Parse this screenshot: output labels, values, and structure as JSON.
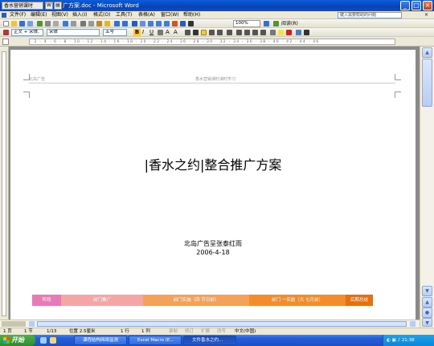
{
  "window": {
    "app_tag": "香水营销课时",
    "doc_title": "广方案.doc - Microsoft Word",
    "min": "_",
    "max": "□",
    "close": "×"
  },
  "menu": {
    "items": [
      "文件(F)",
      "编辑(E)",
      "视图(V)",
      "插入(I)",
      "格式(O)",
      "工具(T)",
      "表格(A)",
      "窗口(W)",
      "帮助(H)"
    ],
    "help_placeholder": "键入需要帮助的问题"
  },
  "toolbar": {
    "zoom": "100%",
    "read_label": "阅读(R)",
    "style": "正文 + 宋体,",
    "font": "宋体",
    "size": "五号"
  },
  "document": {
    "header_left": "北岛广告",
    "header_center": "香水营销课时课时学习",
    "title": "|香水之约|整合推广方案",
    "company": "北岛广告呈张泰红雨",
    "date": "2006-4-18",
    "table_headers": [
      "阶段",
      "前门推广",
      "前门实施（四 节日前）",
      "前门 一实施（大 七月前）",
      "后期总结"
    ],
    "table_colors": [
      "#e87ab5",
      "#f4a6a6",
      "#f4a15a",
      "#f38d2b",
      "#e67010"
    ]
  },
  "status": {
    "page": "1 页",
    "section": "1 节",
    "pos": "1/13",
    "at": "位置 2.5厘米",
    "line": "1 行",
    "col": "1 列",
    "modes": [
      "录制",
      "修订",
      "扩展",
      "改写"
    ],
    "lang": "中文(中国)"
  },
  "taskbar": {
    "start": "开始",
    "tasks": [
      "课程结构网络监测",
      "Excel Macro (E...",
      "文件香水之约..."
    ],
    "clock": "21:38"
  }
}
